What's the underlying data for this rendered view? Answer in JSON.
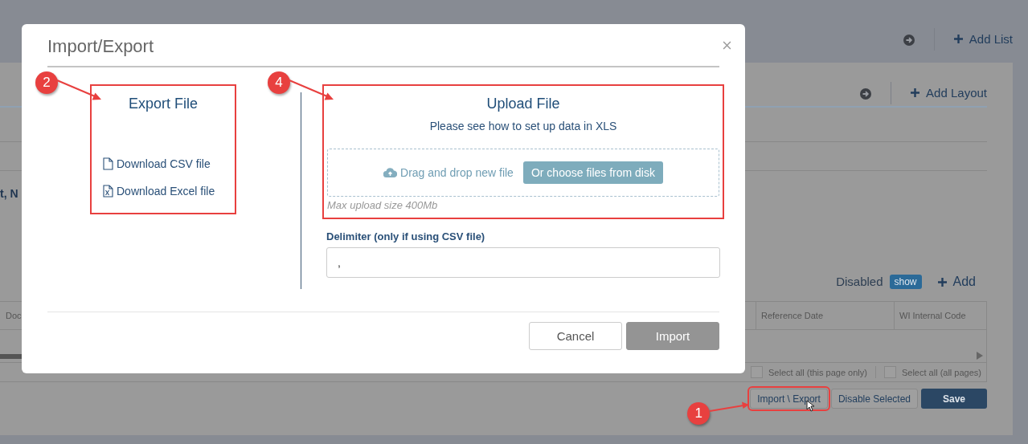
{
  "background": {
    "top_actions": {
      "add_list": "Add List"
    },
    "layout_bar": {
      "add_layout": "Add Layout"
    },
    "partial_text": "t, N",
    "list_header": {
      "disabled_label": "Disabled",
      "show_toggle": "show",
      "add": "Add"
    },
    "table": {
      "columns": [
        "Doc",
        "Reference Date",
        "WI Internal Code"
      ]
    },
    "select_all": [
      {
        "label": "Select all (this page only)",
        "checked": false
      },
      {
        "label": "Select all (all pages)",
        "checked": false
      }
    ],
    "buttons": [
      {
        "label": "Import \\ Export",
        "kind": "outline",
        "callout": "1"
      },
      {
        "label": "Disable Selected",
        "kind": "outline"
      },
      {
        "label": "Save",
        "kind": "primary"
      }
    ]
  },
  "dialog": {
    "title": "Import/Export",
    "export": {
      "title": "Export File",
      "callout": "2",
      "links": [
        {
          "label": "Download CSV file",
          "kind": "csv"
        },
        {
          "label": "Download Excel file",
          "kind": "excel"
        }
      ]
    },
    "upload": {
      "title": "Upload File",
      "callout": "4",
      "subtitle": "Please see how to set up data in XLS",
      "drop_label": "Drag and drop new file",
      "choose_button": "Or choose files from disk",
      "hint": "Max upload size 400Mb"
    },
    "delimiter": {
      "label": "Delimiter (only if using CSV file)",
      "value": ","
    },
    "buttons": [
      {
        "label": "Cancel",
        "disabled": false
      },
      {
        "label": "Import",
        "disabled": true
      }
    ]
  }
}
